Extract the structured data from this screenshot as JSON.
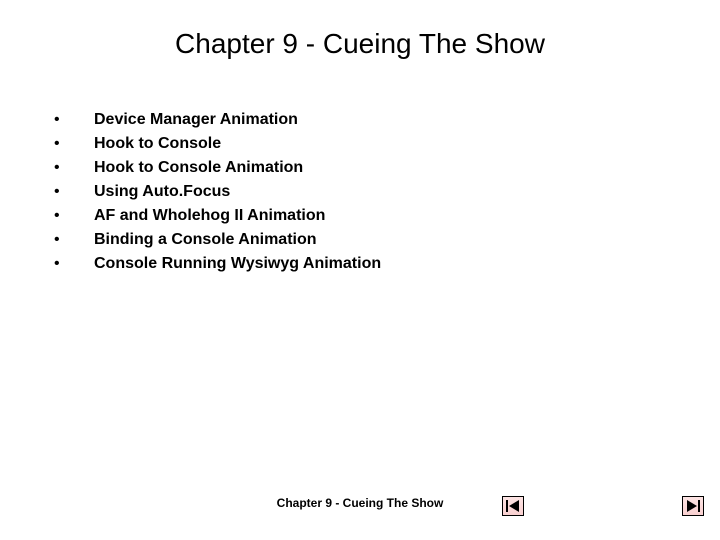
{
  "title": "Chapter 9 - Cueing The Show",
  "bullets": [
    "Device Manager Animation",
    "Hook to Console",
    "Hook to Console Animation",
    "Using Auto.Focus",
    "AF and Wholehog II Animation",
    "Binding a Console Animation",
    "Console Running Wysiwyg Animation"
  ],
  "footer": "Chapter 9 - Cueing The Show",
  "nav": {
    "prev_icon": "skip-back-icon",
    "next_icon": "skip-forward-icon"
  },
  "colors": {
    "button_bg_top": "#fce4e4",
    "button_bg_bottom": "#f9d0d0",
    "text": "#000000",
    "background": "#ffffff"
  }
}
